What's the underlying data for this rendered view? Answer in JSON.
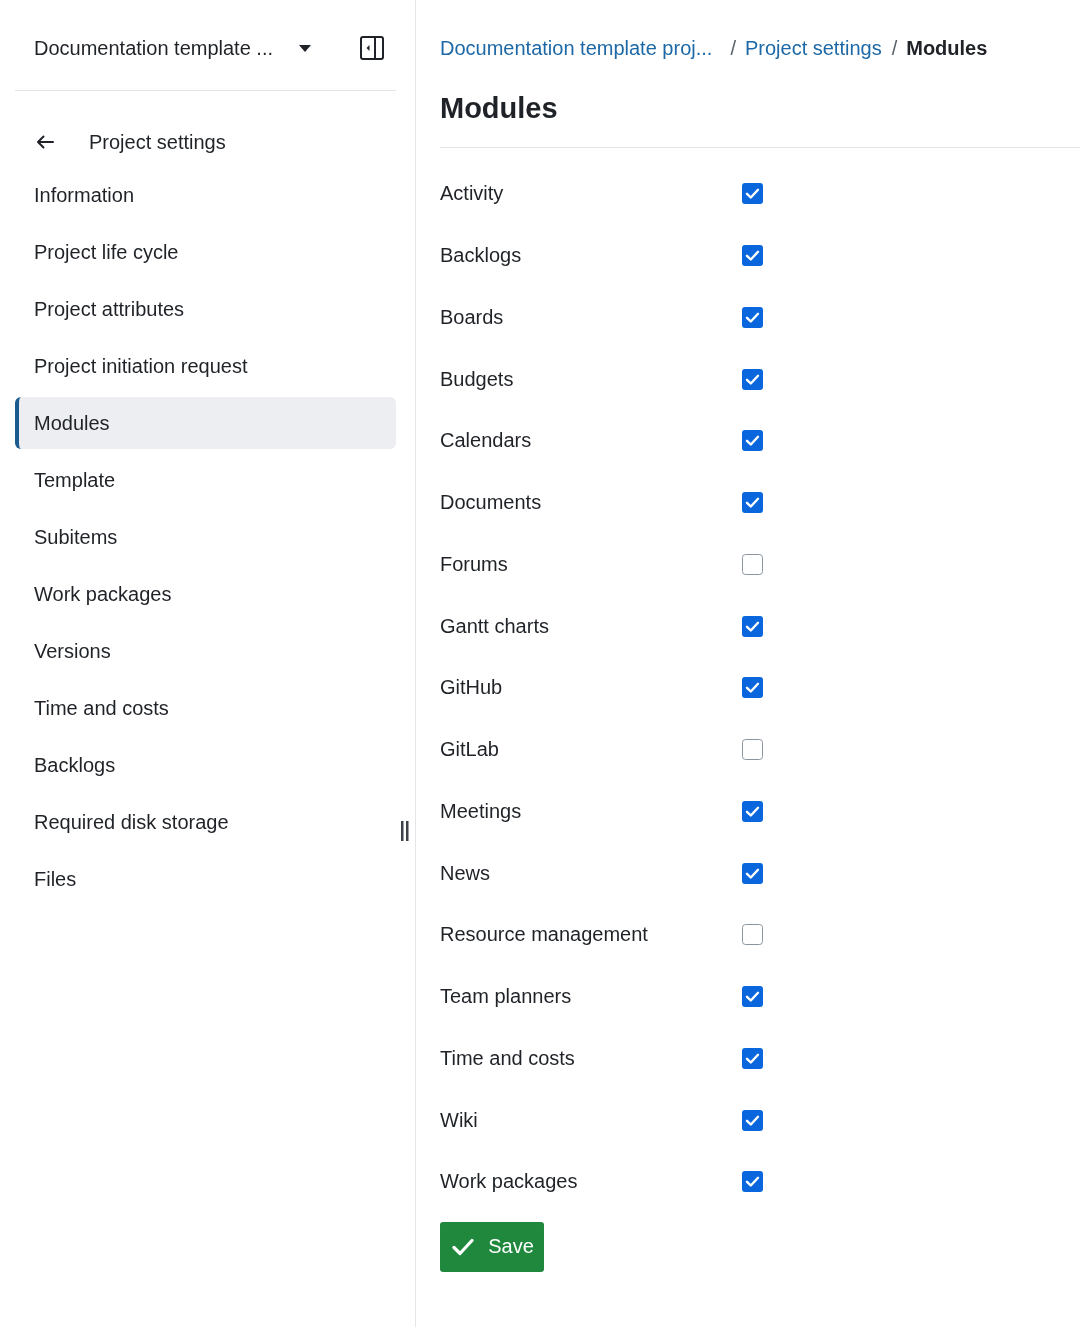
{
  "sidebar": {
    "project_selector": {
      "label": "Documentation template ..."
    },
    "back_link": {
      "label": "Project settings"
    },
    "items": [
      {
        "label": "Information",
        "selected": false
      },
      {
        "label": "Project life cycle",
        "selected": false
      },
      {
        "label": "Project attributes",
        "selected": false
      },
      {
        "label": "Project initiation request",
        "selected": false
      },
      {
        "label": "Modules",
        "selected": true
      },
      {
        "label": "Template",
        "selected": false
      },
      {
        "label": "Subitems",
        "selected": false
      },
      {
        "label": "Work packages",
        "selected": false
      },
      {
        "label": "Versions",
        "selected": false
      },
      {
        "label": "Time and costs",
        "selected": false
      },
      {
        "label": "Backlogs",
        "selected": false
      },
      {
        "label": "Required disk storage",
        "selected": false
      },
      {
        "label": "Files",
        "selected": false
      }
    ]
  },
  "breadcrumb": {
    "separator": "/",
    "items": [
      {
        "label": "Documentation template proj...",
        "kind": "link"
      },
      {
        "label": "Project settings",
        "kind": "link"
      },
      {
        "label": "Modules",
        "kind": "current"
      }
    ]
  },
  "title": "Modules",
  "modules": [
    {
      "label": "Activity",
      "checked": true
    },
    {
      "label": "Backlogs",
      "checked": true
    },
    {
      "label": "Boards",
      "checked": true
    },
    {
      "label": "Budgets",
      "checked": true
    },
    {
      "label": "Calendars",
      "checked": true
    },
    {
      "label": "Documents",
      "checked": true
    },
    {
      "label": "Forums",
      "checked": false
    },
    {
      "label": "Gantt charts",
      "checked": true
    },
    {
      "label": "GitHub",
      "checked": true
    },
    {
      "label": "GitLab",
      "checked": false
    },
    {
      "label": "Meetings",
      "checked": true
    },
    {
      "label": "News",
      "checked": true
    },
    {
      "label": "Resource management",
      "checked": false
    },
    {
      "label": "Team planners",
      "checked": true
    },
    {
      "label": "Time and costs",
      "checked": true
    },
    {
      "label": "Wiki",
      "checked": true
    },
    {
      "label": "Work packages",
      "checked": true
    }
  ],
  "save_button": {
    "label": "Save"
  }
}
